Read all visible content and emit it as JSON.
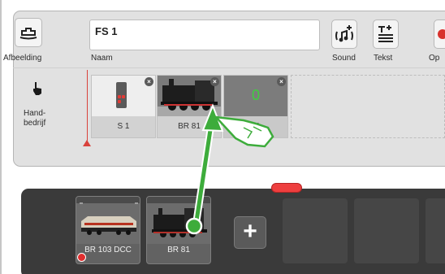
{
  "toolbar": {
    "image_label": "Afbeelding",
    "name_label": "Naam",
    "name_value": "FS 1",
    "sound_label": "Sound",
    "text_label": "Tekst",
    "op_label": "Op"
  },
  "left": {
    "mode_label_1": "Hand-",
    "mode_label_2": "bedrijf"
  },
  "slots": [
    {
      "caption": "S 1",
      "counter": ""
    },
    {
      "caption": "BR 81",
      "counter": ""
    },
    {
      "caption": "81",
      "counter": "0"
    }
  ],
  "tray": {
    "locos": [
      {
        "caption": "BR 103 DCC"
      },
      {
        "caption": "BR 81"
      }
    ],
    "add_label": "+"
  },
  "colors": {
    "accent": "#e33b3b",
    "arrow": "#3dac3b",
    "tray": "#3a3a3a"
  }
}
